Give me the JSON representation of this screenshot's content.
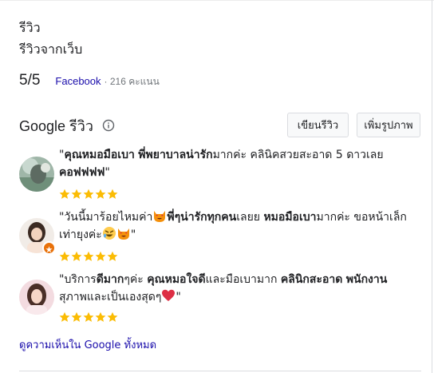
{
  "header": {
    "title": "รีวิว",
    "subtitle": "รีวิวจากเว็บ"
  },
  "web_rating": {
    "score": "5/5",
    "source": "Facebook",
    "count": "· 216 คะแนน"
  },
  "google_reviews": {
    "title": "Google รีวิว",
    "write_button": "เขียนรีวิว",
    "add_photo_button": "เพิ่มรูปภาพ",
    "icons": {
      "info": "info-icon",
      "star": "star-icon",
      "local_guide": "local-guide-badge-icon"
    },
    "colors": {
      "star": "#fbbc04",
      "link": "#1a0dab",
      "badge": "#e8710a"
    },
    "reviews": [
      {
        "parts": [
          "\"",
          "คุณหมอมือเบา",
          " ",
          "พี่พยาบาลน่ารัก",
          "มากค่ะ คลินิคสวยสะอาด 5 ดาวเลย",
          "คอฟฟฟฟ",
          "\""
        ],
        "rating": 5,
        "avatar": "reviewer-1-avatar"
      },
      {
        "parts": [
          "\"วันนี้มาร้อยไหมค่า",
          "พี่ๆน่ารักทุกคน",
          "เลยย ",
          "หมอมือเบา",
          "มากค่ะ ขอหน้าเล็กเท่ายุงค่ะ",
          "\""
        ],
        "emoji": [
          "cat-heart-eyes-emoji",
          "rofl-emoji",
          "cat-heart-eyes-emoji"
        ],
        "rating": 5,
        "avatar": "reviewer-2-avatar",
        "local_guide": true
      },
      {
        "parts": [
          "\"บริการ",
          "ดีมาก",
          "ๆค่ะ ",
          "คุณหมอใจดี",
          "และมือเบามาก ",
          "คลินิกสะอาด",
          " ",
          "พนักงาน",
          "สุภาพและเป็นเองสุดๆ",
          "\""
        ],
        "emoji": [
          "red-heart-emoji"
        ],
        "rating": 5,
        "avatar": "reviewer-3-avatar"
      }
    ],
    "more_link": "ดูความเห็นใน Google ทั้งหมด"
  }
}
